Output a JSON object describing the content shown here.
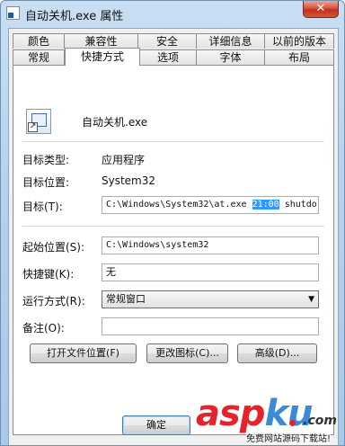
{
  "window": {
    "title": "自动关机.exe 属性",
    "close_label": "✕"
  },
  "tabs": {
    "row1": [
      "颜色",
      "兼容性",
      "安全",
      "详细信息",
      "以前的版本"
    ],
    "row2": [
      "常规",
      "快捷方式",
      "选项",
      "字体",
      "布局"
    ],
    "active": "快捷方式"
  },
  "shortcut": {
    "name": "自动关机.exe",
    "target_type_label": "目标类型:",
    "target_type_value": "应用程序",
    "target_location_label": "目标位置:",
    "target_location_value": "System32",
    "target_label": "目标(T):",
    "target_value_before": "C:\\Windows\\System32\\at.exe ",
    "target_value_selected": "21:00",
    "target_value_after": " shutdo",
    "start_in_label": "起始位置(S):",
    "start_in_value": "C:\\Windows\\system32",
    "hotkey_label": "快捷键(K):",
    "hotkey_value": "无",
    "run_label": "运行方式(R):",
    "run_value": "常规窗口",
    "comment_label": "备注(O):",
    "comment_value": ""
  },
  "buttons": {
    "open_location": "打开文件位置(F)",
    "change_icon": "更改图标(C)...",
    "advanced": "高级(D)...",
    "ok": "确定"
  },
  "watermark": {
    "logo_asp": "asp",
    "logo_ku": "ku",
    "logo_net": ".com",
    "subtitle": "免费网站源码下载站!"
  }
}
